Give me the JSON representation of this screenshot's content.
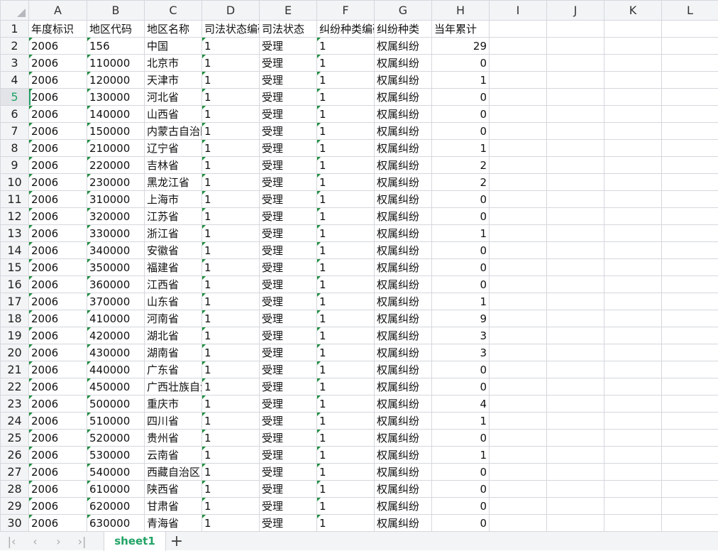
{
  "columns": [
    "A",
    "B",
    "C",
    "D",
    "E",
    "F",
    "G",
    "H",
    "I",
    "J",
    "K",
    "L"
  ],
  "header_row": [
    "年度标识",
    "地区代码",
    "地区名称",
    "司法状态编码",
    "司法状态",
    "纠纷种类编码",
    "纠纷种类",
    "当年累计"
  ],
  "rows": [
    [
      "2006",
      "156",
      "中国",
      "1",
      "受理",
      "1",
      "权属纠纷",
      "29"
    ],
    [
      "2006",
      "110000",
      "北京市",
      "1",
      "受理",
      "1",
      "权属纠纷",
      "0"
    ],
    [
      "2006",
      "120000",
      "天津市",
      "1",
      "受理",
      "1",
      "权属纠纷",
      "1"
    ],
    [
      "2006",
      "130000",
      "河北省",
      "1",
      "受理",
      "1",
      "权属纠纷",
      "0"
    ],
    [
      "2006",
      "140000",
      "山西省",
      "1",
      "受理",
      "1",
      "权属纠纷",
      "0"
    ],
    [
      "2006",
      "150000",
      "内蒙古自治区",
      "1",
      "受理",
      "1",
      "权属纠纷",
      "0"
    ],
    [
      "2006",
      "210000",
      "辽宁省",
      "1",
      "受理",
      "1",
      "权属纠纷",
      "1"
    ],
    [
      "2006",
      "220000",
      "吉林省",
      "1",
      "受理",
      "1",
      "权属纠纷",
      "2"
    ],
    [
      "2006",
      "230000",
      "黑龙江省",
      "1",
      "受理",
      "1",
      "权属纠纷",
      "2"
    ],
    [
      "2006",
      "310000",
      "上海市",
      "1",
      "受理",
      "1",
      "权属纠纷",
      "0"
    ],
    [
      "2006",
      "320000",
      "江苏省",
      "1",
      "受理",
      "1",
      "权属纠纷",
      "0"
    ],
    [
      "2006",
      "330000",
      "浙江省",
      "1",
      "受理",
      "1",
      "权属纠纷",
      "1"
    ],
    [
      "2006",
      "340000",
      "安徽省",
      "1",
      "受理",
      "1",
      "权属纠纷",
      "0"
    ],
    [
      "2006",
      "350000",
      "福建省",
      "1",
      "受理",
      "1",
      "权属纠纷",
      "0"
    ],
    [
      "2006",
      "360000",
      "江西省",
      "1",
      "受理",
      "1",
      "权属纠纷",
      "0"
    ],
    [
      "2006",
      "370000",
      "山东省",
      "1",
      "受理",
      "1",
      "权属纠纷",
      "1"
    ],
    [
      "2006",
      "410000",
      "河南省",
      "1",
      "受理",
      "1",
      "权属纠纷",
      "9"
    ],
    [
      "2006",
      "420000",
      "湖北省",
      "1",
      "受理",
      "1",
      "权属纠纷",
      "3"
    ],
    [
      "2006",
      "430000",
      "湖南省",
      "1",
      "受理",
      "1",
      "权属纠纷",
      "3"
    ],
    [
      "2006",
      "440000",
      "广东省",
      "1",
      "受理",
      "1",
      "权属纠纷",
      "0"
    ],
    [
      "2006",
      "450000",
      "广西壮族自治区",
      "1",
      "受理",
      "1",
      "权属纠纷",
      "0"
    ],
    [
      "2006",
      "500000",
      "重庆市",
      "1",
      "受理",
      "1",
      "权属纠纷",
      "4"
    ],
    [
      "2006",
      "510000",
      "四川省",
      "1",
      "受理",
      "1",
      "权属纠纷",
      "1"
    ],
    [
      "2006",
      "520000",
      "贵州省",
      "1",
      "受理",
      "1",
      "权属纠纷",
      "0"
    ],
    [
      "2006",
      "530000",
      "云南省",
      "1",
      "受理",
      "1",
      "权属纠纷",
      "1"
    ],
    [
      "2006",
      "540000",
      "西藏自治区",
      "1",
      "受理",
      "1",
      "权属纠纷",
      "0"
    ],
    [
      "2006",
      "610000",
      "陕西省",
      "1",
      "受理",
      "1",
      "权属纠纷",
      "0"
    ],
    [
      "2006",
      "620000",
      "甘肃省",
      "1",
      "受理",
      "1",
      "权属纠纷",
      "0"
    ],
    [
      "2006",
      "630000",
      "青海省",
      "1",
      "受理",
      "1",
      "权属纠纷",
      "0"
    ]
  ],
  "active_row": 5,
  "sheet_tabs": [
    "sheet1"
  ],
  "nav_icons": [
    "first-sheet-icon",
    "prev-sheet-icon",
    "next-sheet-icon",
    "last-sheet-icon"
  ],
  "add_sheet_icon": "+",
  "accent": "#21a366"
}
